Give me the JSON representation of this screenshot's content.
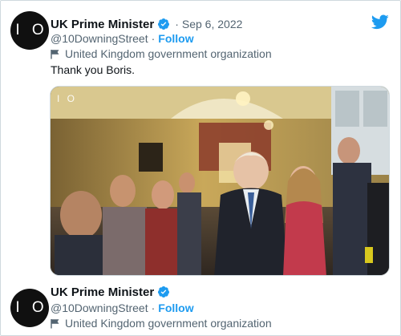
{
  "tweets": [
    {
      "avatar_text": "I O",
      "display_name": "UK Prime Minister",
      "verified_icon": "verified-badge-icon",
      "separator": "·",
      "date": "Sep 6, 2022",
      "handle": "@10DowningStreet",
      "handle_separator": "·",
      "follow_label": "Follow",
      "org_label": "United Kingdom government organization",
      "text": "Thank you Boris.",
      "media_watermark": "I O"
    },
    {
      "avatar_text": "I O",
      "display_name": "UK Prime Minister",
      "verified_icon": "verified-badge-icon",
      "handle": "@10DowningStreet",
      "handle_separator": "·",
      "follow_label": "Follow",
      "org_label": "United Kingdom government organization"
    }
  ],
  "colors": {
    "accent": "#1d9bf0",
    "secondary_text": "#536471",
    "primary_text": "#0f1419"
  },
  "icons": {
    "brand": "twitter-bird-icon",
    "org_label": "flag-icon"
  }
}
